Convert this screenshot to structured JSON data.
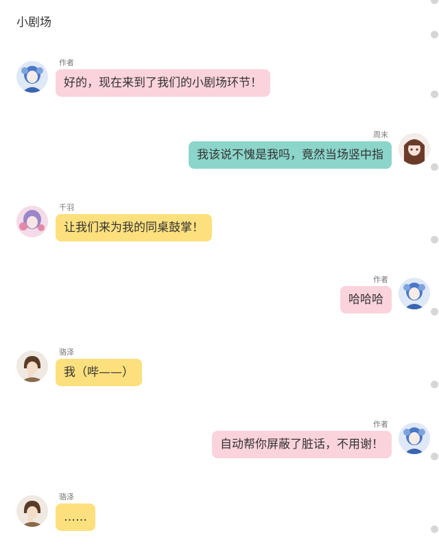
{
  "header": {
    "title": "小剧场"
  },
  "messages": [
    {
      "name": "作者",
      "text": "好的，现在来到了我们的小剧场环节！"
    },
    {
      "name": "周末",
      "text": "我该说不愧是我吗，竟然当场竖中指"
    },
    {
      "name": "千羽",
      "text": "让我们来为我的同桌鼓掌！"
    },
    {
      "name": "作者",
      "text": "哈哈哈"
    },
    {
      "name": "骆泽",
      "text": "我（哔——）"
    },
    {
      "name": "作者",
      "text": "自动帮你屏蔽了脏话，不用谢！"
    },
    {
      "name": "骆泽",
      "text": "……"
    }
  ],
  "colors": {
    "author_bubble": "#fbd3dc",
    "zhoumo_bubble": "#8bd5ca",
    "other_bubble": "#fde07e"
  }
}
